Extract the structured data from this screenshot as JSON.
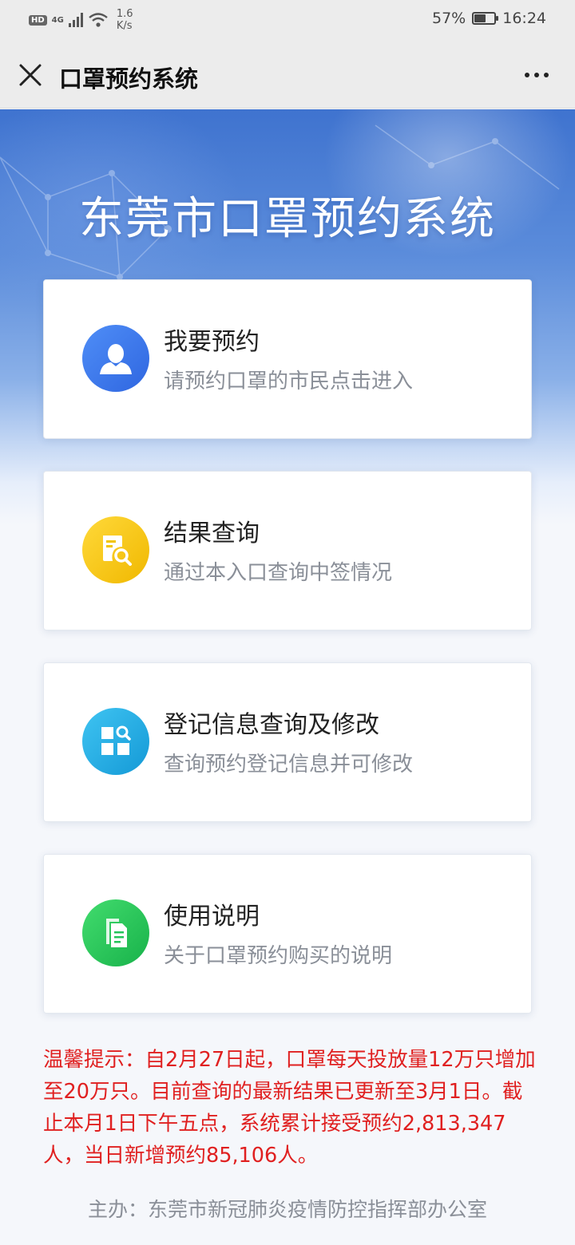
{
  "status_bar": {
    "hd_badge": "HD",
    "network": "4G",
    "speed_value": "1.6",
    "speed_unit": "K/s",
    "battery_percent": "57%",
    "battery_level": 0.57,
    "time": "16:24"
  },
  "title_bar": {
    "title": "口罩预约系统",
    "close_icon": "close-icon",
    "more_icon": "more-icon"
  },
  "hero": {
    "title": "东莞市口罩预约系统"
  },
  "cards": [
    {
      "title": "我要预约",
      "subtitle": "请预约口罩的市民点击进入",
      "icon": "user-icon",
      "color": "#3f7cf0"
    },
    {
      "title": "结果查询",
      "subtitle": "通过本入口查询中签情况",
      "icon": "document-search-icon",
      "color": "#f2c500"
    },
    {
      "title": "登记信息查询及修改",
      "subtitle": "查询预约登记信息并可修改",
      "icon": "grid-search-icon",
      "color": "#1fb0e8"
    },
    {
      "title": "使用说明",
      "subtitle": "关于口罩预约购买的说明",
      "icon": "documents-icon",
      "color": "#24c45a"
    }
  ],
  "notice": "温馨提示：自2月27日起，口罩每天投放量12万只增加至20万只。目前查询的最新结果已更新至3月1日。截止本月1日下午五点，系统累计接受预约2,813,347人，当日新增预约85,106人。",
  "footer": "主办：东莞市新冠肺炎疫情防控指挥部办公室"
}
